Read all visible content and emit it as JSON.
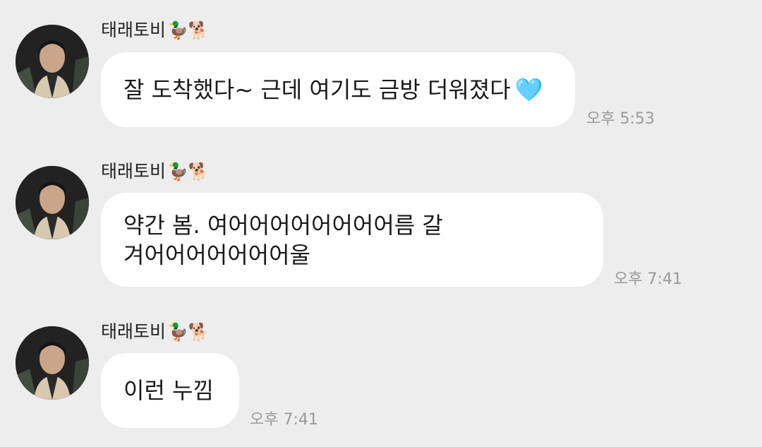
{
  "messages": [
    {
      "sender": "태래토비",
      "sender_emoji": "🦆🐕",
      "text": "잘 도착했다~ 근데 여기도 금방 더워졌다",
      "text_emoji": "🩵",
      "time": "오후 5:53"
    },
    {
      "sender": "태래토비",
      "sender_emoji": "🦆🐕",
      "text": "약간 봄.  여어어어어어어어어름 갈\n겨어어어어어어어울",
      "time": "오후 7:41"
    },
    {
      "sender": "태래토비",
      "sender_emoji": "🦆🐕",
      "text": "이런 누낌",
      "time": "오후 7:41"
    }
  ]
}
